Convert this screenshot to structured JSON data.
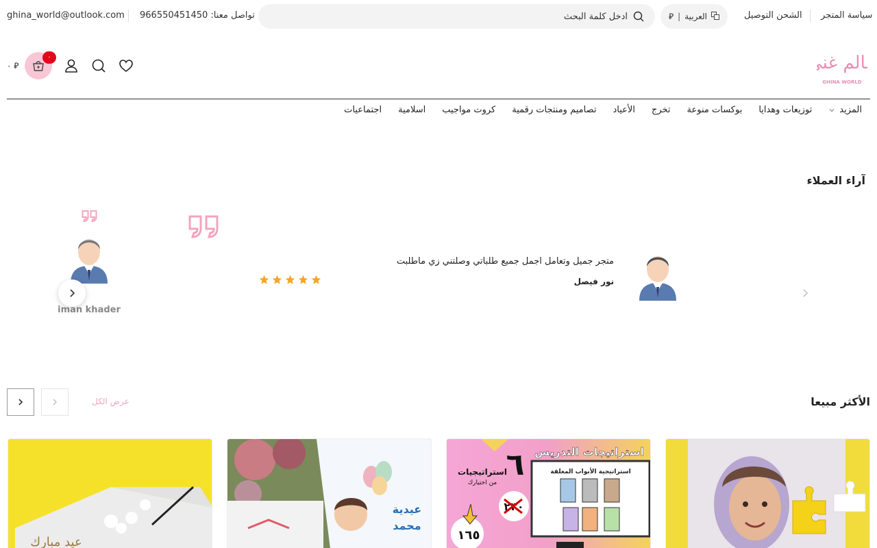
{
  "topbar": {
    "email": "ghina_world@outlook.com",
    "phone": "تواصل معنا: 966550451450",
    "search_placeholder": "ادخل كلمة البحث",
    "language": "العربية",
    "currency_symbol": "⃁",
    "links": [
      "الشحن التوصيل",
      "سياسة المتجر"
    ]
  },
  "header": {
    "logo_text": "عالم غنى",
    "logo_subtext": "GHINA WORLD",
    "cart_count": "٠",
    "cart_total": "٠ ⃁"
  },
  "nav": {
    "items": [
      "اجتماعيات",
      "اسلامية",
      "كروت مواجيب",
      "تصاميم ومنتجات رقمية",
      "الأعياد",
      "تخرج",
      "بوكسات منوعة",
      "توزيعات وهدايا"
    ],
    "more_label": "المزيد"
  },
  "reviews": {
    "title": "آراء العملاء",
    "active": {
      "text": "متجر جميل وتعامل اجمل جميع طلباتي وصلتني زي ماطلبت",
      "name": "نور فيصل",
      "rating": 5
    },
    "next_name": "iman khader"
  },
  "bestsellers": {
    "title": "الأكثر مبيعا",
    "view_all": "عرض الكل",
    "cards": [
      {
        "alt": "puzzle-product",
        "price_label": ""
      },
      {
        "alt": "teaching-strategies",
        "headline": "استراتيجات التدريس",
        "sub": "استراتيجية الأبواب المغلقة",
        "num": "٦",
        "num_label": "استراتيجيات",
        "num_sub": "من اختيارك",
        "old_price": "٢٣٠",
        "new_price": "١٦٥"
      },
      {
        "alt": "eid-gift",
        "label1": "عيدية",
        "label2": "محمد"
      },
      {
        "alt": "eid-card",
        "label": "عيد مبارك"
      }
    ]
  },
  "colors": {
    "accent": "#f7c7d6",
    "accent_text": "#f3a4bd",
    "badge": "#e3071a",
    "star": "#f5a623",
    "logo": "#e88fb1"
  }
}
